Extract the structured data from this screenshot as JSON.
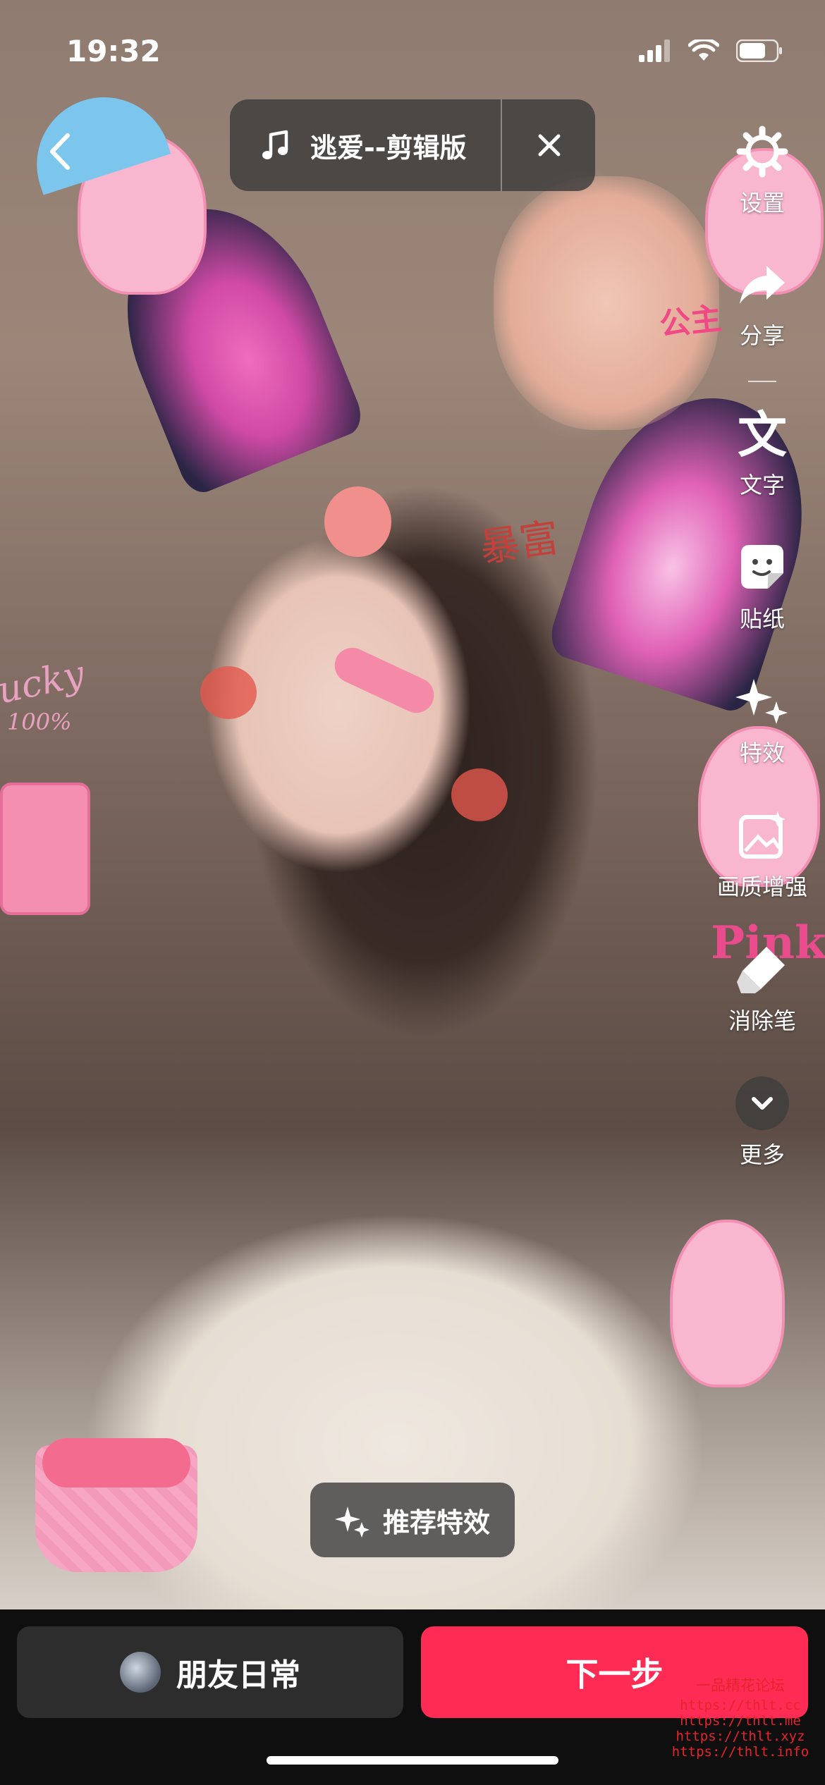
{
  "status_bar": {
    "time": "19:32"
  },
  "music": {
    "title": "逃爱--剪辑版"
  },
  "tools": [
    {
      "label": "设置",
      "icon": "gear-icon"
    },
    {
      "label": "分享",
      "icon": "share-icon"
    },
    {
      "label": "文字",
      "icon": "text-icon"
    },
    {
      "label": "贴纸",
      "icon": "sticker-icon"
    },
    {
      "label": "特效",
      "icon": "sparkles-icon"
    },
    {
      "label": "画质增强",
      "icon": "image-enhance-icon"
    },
    {
      "label": "消除笔",
      "icon": "eraser-icon"
    },
    {
      "label": "更多",
      "icon": "chevron-down-icon"
    }
  ],
  "recommend_effects": {
    "label": "推荐特效"
  },
  "bottom": {
    "friends_label": "朋友日常",
    "next_label": "下一步"
  },
  "stickers": {
    "baofu": "暴富",
    "lucky": "lucky",
    "percent": "100%",
    "pink": "Pink",
    "gongzhu": "公主"
  },
  "watermark": {
    "title": "一品精花论坛",
    "lines": [
      "https://thlt.cc",
      "https://thlt.me",
      "https://thlt.xyz",
      "https://thlt.info"
    ]
  },
  "colors": {
    "accent": "#fe2c55",
    "pink": "#f7a6c4"
  }
}
